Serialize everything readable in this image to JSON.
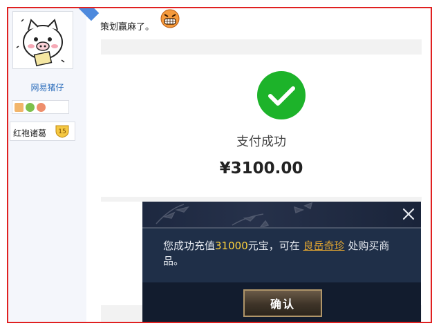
{
  "sidebar": {
    "username": "网易猪仔",
    "rank_name": "红袍诸葛",
    "rank_level": "15"
  },
  "post": {
    "text": "策划赢麻了。"
  },
  "payment": {
    "status": "支付成功",
    "amount": "¥3100.00"
  },
  "dialog": {
    "msg_prefix": "您成功充值",
    "amount": "31000",
    "msg_mid": "元宝，可在",
    "link": "良岳奇珍",
    "msg_suffix": "处购买商品。",
    "confirm_label": "确认"
  },
  "colors": {
    "frame": "#e02020",
    "success_green": "#1db32a",
    "link_gold": "#e2a631",
    "amount_yellow": "#ffd23c"
  }
}
